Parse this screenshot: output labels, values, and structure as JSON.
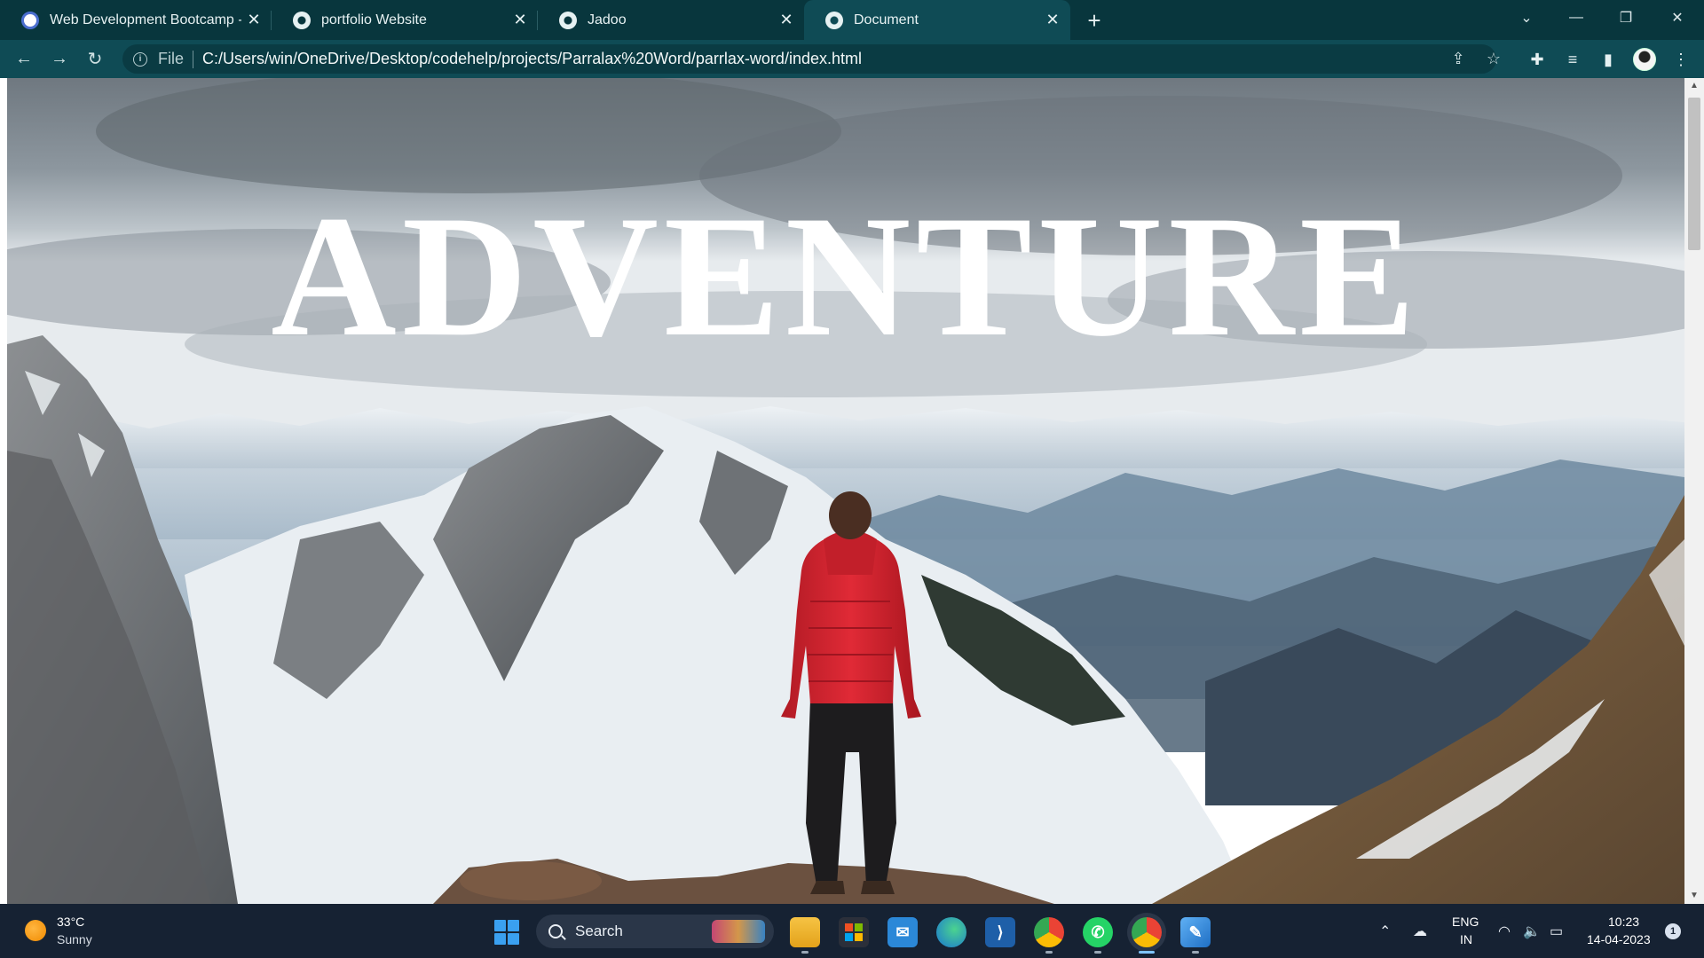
{
  "browser": {
    "tabs": [
      {
        "title": "Web Development Bootcamp - C",
        "icon": "codehelp-favicon",
        "active": false
      },
      {
        "title": "portfolio Website",
        "icon": "globe-icon",
        "active": false
      },
      {
        "title": "Jadoo",
        "icon": "globe-icon",
        "active": false
      },
      {
        "title": "Document",
        "icon": "globe-icon",
        "active": true
      }
    ],
    "new_tab_label": "+",
    "address": {
      "scheme_label": "File",
      "url": "C:/Users/win/OneDrive/Desktop/codehelp/projects/Parralax%20Word/parrlax-word/index.html"
    }
  },
  "page": {
    "headline": "ADVENTURE",
    "colors": {
      "sky": "#7f8a94",
      "snow": "#eef2f5",
      "jacket": "#d8232f",
      "headline": "#ffffff"
    }
  },
  "taskbar": {
    "weather": {
      "temp": "33°C",
      "condition": "Sunny"
    },
    "search_label": "Search",
    "apps": [
      "file-explorer-icon",
      "microsoft-store-icon",
      "mail-icon",
      "edge-icon",
      "vscode-icon",
      "chrome-icon",
      "whatsapp-icon",
      "chrome-active-icon",
      "paint-icon"
    ],
    "language": {
      "line1": "ENG",
      "line2": "IN"
    },
    "clock": {
      "time": "10:23",
      "date": "14-04-2023"
    },
    "notifications": "1"
  }
}
